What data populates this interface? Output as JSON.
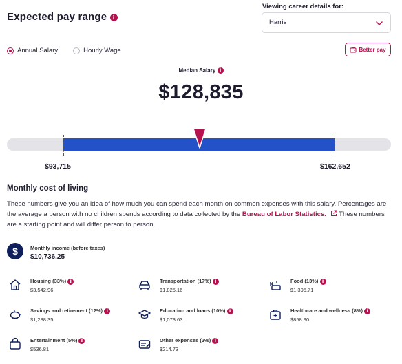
{
  "header": {
    "title": "Expected pay range",
    "viewing_label": "Viewing career details for:",
    "selected_location": "Harris"
  },
  "toggle": {
    "options": [
      "Annual Salary",
      "Hourly Wage"
    ],
    "selected": "Annual Salary"
  },
  "better_pay_label": "Better pay",
  "salary": {
    "median_label": "Median Salary",
    "median_value": "$128,835",
    "low_value": "$93,715",
    "high_value": "$162,652",
    "median_fraction_of_range": 0.5
  },
  "cost_of_living": {
    "heading": "Monthly cost of living",
    "paragraph_pre": "These numbers give you an idea of how much you can spend each month on common expenses with this salary. Percentages are the average a person with no children spends according to data collected by the ",
    "link_text": "Bureau of Labor Statistics.",
    "paragraph_post": " These numbers are a starting point and will differ person to person.",
    "income_label": "Monthly income (before taxes)",
    "income_value": "$10,736.25",
    "expenses": [
      {
        "label": "Housing (33%)",
        "value": "$3,542.96",
        "icon": "home-icon"
      },
      {
        "label": "Transportation (17%)",
        "value": "$1,825.16",
        "icon": "car-icon"
      },
      {
        "label": "Food (13%)",
        "value": "$1,395.71",
        "icon": "food-icon"
      },
      {
        "label": "Savings and retirement (12%)",
        "value": "$1,288.35",
        "icon": "piggy-bank-icon"
      },
      {
        "label": "Education and loans (10%)",
        "value": "$1,073.63",
        "icon": "graduation-cap-icon"
      },
      {
        "label": "Healthcare and wellness (8%)",
        "value": "$858.90",
        "icon": "medical-kit-icon"
      },
      {
        "label": "Entertainment (5%)",
        "value": "$536.81",
        "icon": "ticket-icon"
      },
      {
        "label": "Other expenses (2%)",
        "value": "$214.73",
        "icon": "receipt-icon"
      }
    ]
  },
  "colors": {
    "accent": "#b5124f",
    "bar_fill": "#2351c7",
    "bar_track": "#e3e3e8",
    "income_circle": "#0f1f5c"
  }
}
